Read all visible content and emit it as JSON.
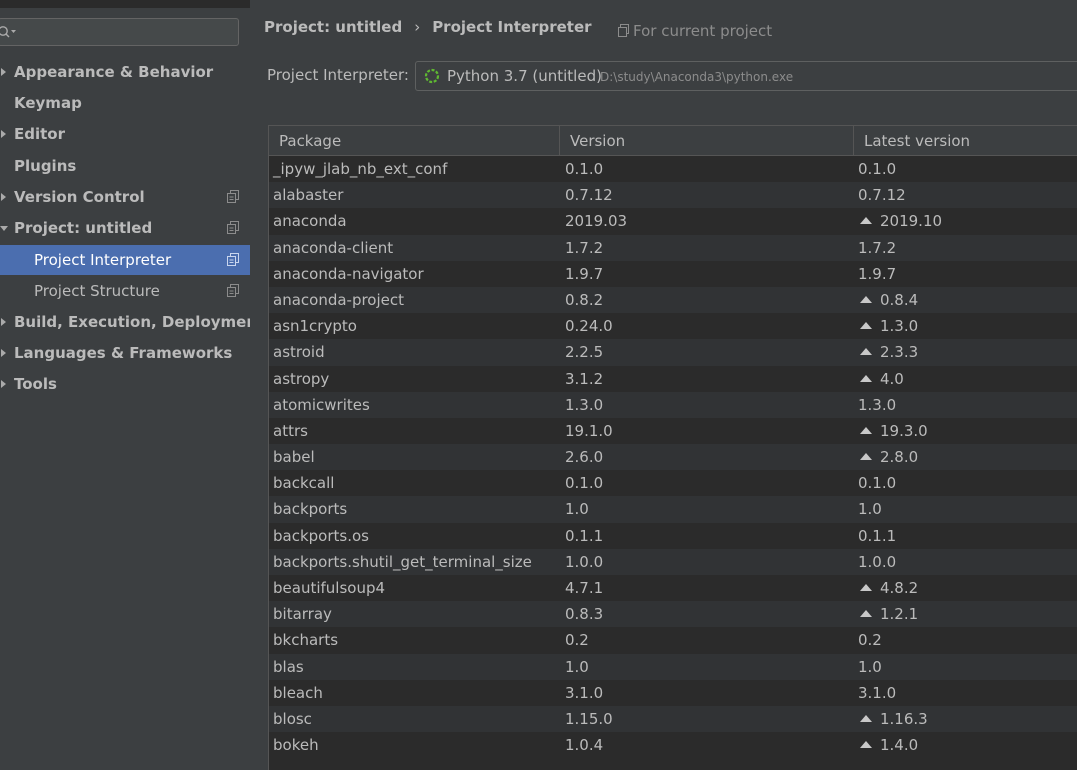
{
  "sidebar": {
    "search": {
      "value": "",
      "placeholder": ""
    },
    "items": [
      {
        "label": "Appearance & Behavior",
        "arrow": "right",
        "bold": true,
        "child": false,
        "copy": false,
        "selected": false
      },
      {
        "label": "Keymap",
        "arrow": "none",
        "bold": true,
        "child": false,
        "copy": false,
        "selected": false
      },
      {
        "label": "Editor",
        "arrow": "right",
        "bold": true,
        "child": false,
        "copy": false,
        "selected": false
      },
      {
        "label": "Plugins",
        "arrow": "none",
        "bold": true,
        "child": false,
        "copy": false,
        "selected": false
      },
      {
        "label": "Version Control",
        "arrow": "right",
        "bold": true,
        "child": false,
        "copy": true,
        "selected": false
      },
      {
        "label": "Project: untitled",
        "arrow": "down",
        "bold": true,
        "child": false,
        "copy": true,
        "selected": false
      },
      {
        "label": "Project Interpreter",
        "arrow": "none",
        "bold": false,
        "child": true,
        "copy": true,
        "selected": true
      },
      {
        "label": "Project Structure",
        "arrow": "none",
        "bold": false,
        "child": true,
        "copy": true,
        "selected": false
      },
      {
        "label": "Build, Execution, Deployment",
        "arrow": "right",
        "bold": true,
        "child": false,
        "copy": false,
        "selected": false
      },
      {
        "label": "Languages & Frameworks",
        "arrow": "right",
        "bold": true,
        "child": false,
        "copy": false,
        "selected": false
      },
      {
        "label": "Tools",
        "arrow": "right",
        "bold": true,
        "child": false,
        "copy": false,
        "selected": false
      }
    ]
  },
  "header": {
    "crumb_parent": "Project: untitled",
    "crumb_separator": "›",
    "crumb_current": "Project Interpreter",
    "for_current": "For current project"
  },
  "interpreter": {
    "label": "Project Interpreter:",
    "name": "Python 3.7 (untitled)",
    "path": "D:\\study\\Anaconda3\\python.exe"
  },
  "table": {
    "columns": [
      "Package",
      "Version",
      "Latest version"
    ],
    "rows": [
      {
        "package": "_ipyw_jlab_nb_ext_conf",
        "version": "0.1.0",
        "latest": "0.1.0",
        "upgrade": false
      },
      {
        "package": "alabaster",
        "version": "0.7.12",
        "latest": "0.7.12",
        "upgrade": false
      },
      {
        "package": "anaconda",
        "version": "2019.03",
        "latest": "2019.10",
        "upgrade": true
      },
      {
        "package": "anaconda-client",
        "version": "1.7.2",
        "latest": "1.7.2",
        "upgrade": false
      },
      {
        "package": "anaconda-navigator",
        "version": "1.9.7",
        "latest": "1.9.7",
        "upgrade": false
      },
      {
        "package": "anaconda-project",
        "version": "0.8.2",
        "latest": "0.8.4",
        "upgrade": true
      },
      {
        "package": "asn1crypto",
        "version": "0.24.0",
        "latest": "1.3.0",
        "upgrade": true
      },
      {
        "package": "astroid",
        "version": "2.2.5",
        "latest": "2.3.3",
        "upgrade": true
      },
      {
        "package": "astropy",
        "version": "3.1.2",
        "latest": "4.0",
        "upgrade": true
      },
      {
        "package": "atomicwrites",
        "version": "1.3.0",
        "latest": "1.3.0",
        "upgrade": false
      },
      {
        "package": "attrs",
        "version": "19.1.0",
        "latest": "19.3.0",
        "upgrade": true
      },
      {
        "package": "babel",
        "version": "2.6.0",
        "latest": "2.8.0",
        "upgrade": true
      },
      {
        "package": "backcall",
        "version": "0.1.0",
        "latest": "0.1.0",
        "upgrade": false
      },
      {
        "package": "backports",
        "version": "1.0",
        "latest": "1.0",
        "upgrade": false
      },
      {
        "package": "backports.os",
        "version": "0.1.1",
        "latest": "0.1.1",
        "upgrade": false
      },
      {
        "package": "backports.shutil_get_terminal_size",
        "version": "1.0.0",
        "latest": "1.0.0",
        "upgrade": false
      },
      {
        "package": "beautifulsoup4",
        "version": "4.7.1",
        "latest": "4.8.2",
        "upgrade": true
      },
      {
        "package": "bitarray",
        "version": "0.8.3",
        "latest": "1.2.1",
        "upgrade": true
      },
      {
        "package": "bkcharts",
        "version": "0.2",
        "latest": "0.2",
        "upgrade": false
      },
      {
        "package": "blas",
        "version": "1.0",
        "latest": "1.0",
        "upgrade": false
      },
      {
        "package": "bleach",
        "version": "3.1.0",
        "latest": "3.1.0",
        "upgrade": false
      },
      {
        "package": "blosc",
        "version": "1.15.0",
        "latest": "1.16.3",
        "upgrade": true
      },
      {
        "package": "bokeh",
        "version": "1.0.4",
        "latest": "1.4.0",
        "upgrade": true
      }
    ]
  },
  "colors": {
    "background": "#3c3f41",
    "table_background": "#2b2b2b",
    "selected": "#4b6eaf",
    "text": "#bbbbbb",
    "muted": "#8c8c8c",
    "interpreter_icon": "#5fb832"
  },
  "icons": {
    "search": "search-icon",
    "copy": "project-level-icon",
    "interpreter": "python-sdk-icon",
    "upgrade": "upgrade-arrow-icon"
  }
}
